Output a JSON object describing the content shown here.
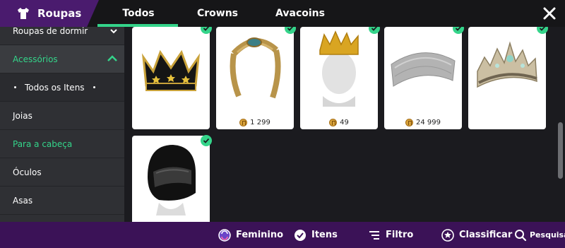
{
  "header": {
    "brand_label": "Roupas",
    "tabs": [
      {
        "label": "Todos",
        "active": true
      },
      {
        "label": "Crowns",
        "active": false
      },
      {
        "label": "Avacoins",
        "active": false
      }
    ],
    "close_icon": "close-icon"
  },
  "sidebar": {
    "items": [
      {
        "label": "Roupas de dormir",
        "state": "collapsed"
      },
      {
        "label": "Acessórios",
        "state": "expanded"
      },
      {
        "label": "Todos os Itens"
      },
      {
        "label": "Joias"
      },
      {
        "label": "Para a cabeça",
        "selected": true
      },
      {
        "label": "Óculos"
      },
      {
        "label": "Asas"
      }
    ]
  },
  "grid": {
    "items": [
      {
        "name": "black-gold-crown",
        "price": "",
        "owned": true
      },
      {
        "name": "gold-leaf-headband",
        "price": "1 299",
        "owned": true
      },
      {
        "name": "gold-crown-on-mannequin",
        "price": "49",
        "owned": true
      },
      {
        "name": "silver-headband",
        "price": "24 999",
        "owned": true
      },
      {
        "name": "jeweled-silver-tiara",
        "price": "",
        "owned": true
      },
      {
        "name": "motorcycle-helmet",
        "price": "",
        "owned": true
      }
    ]
  },
  "bottom_bar": {
    "buttons": [
      {
        "label": "Feminino",
        "icon": "gender-swap-icon"
      },
      {
        "label": "Itens",
        "icon": "check-circle-icon"
      },
      {
        "label": "Filtro",
        "icon": "filter-icon"
      },
      {
        "label": "Classificar",
        "icon": "star-icon"
      },
      {
        "label": "Pesquisa",
        "icon": "search-icon"
      }
    ]
  },
  "colors": {
    "accent_green": "#34d48a",
    "brand_purple": "#4a1b6e",
    "bottom_bar_purple": "#3b1257",
    "sidebar_bg": "#2f3034",
    "page_bg": "#1b1b1f"
  }
}
